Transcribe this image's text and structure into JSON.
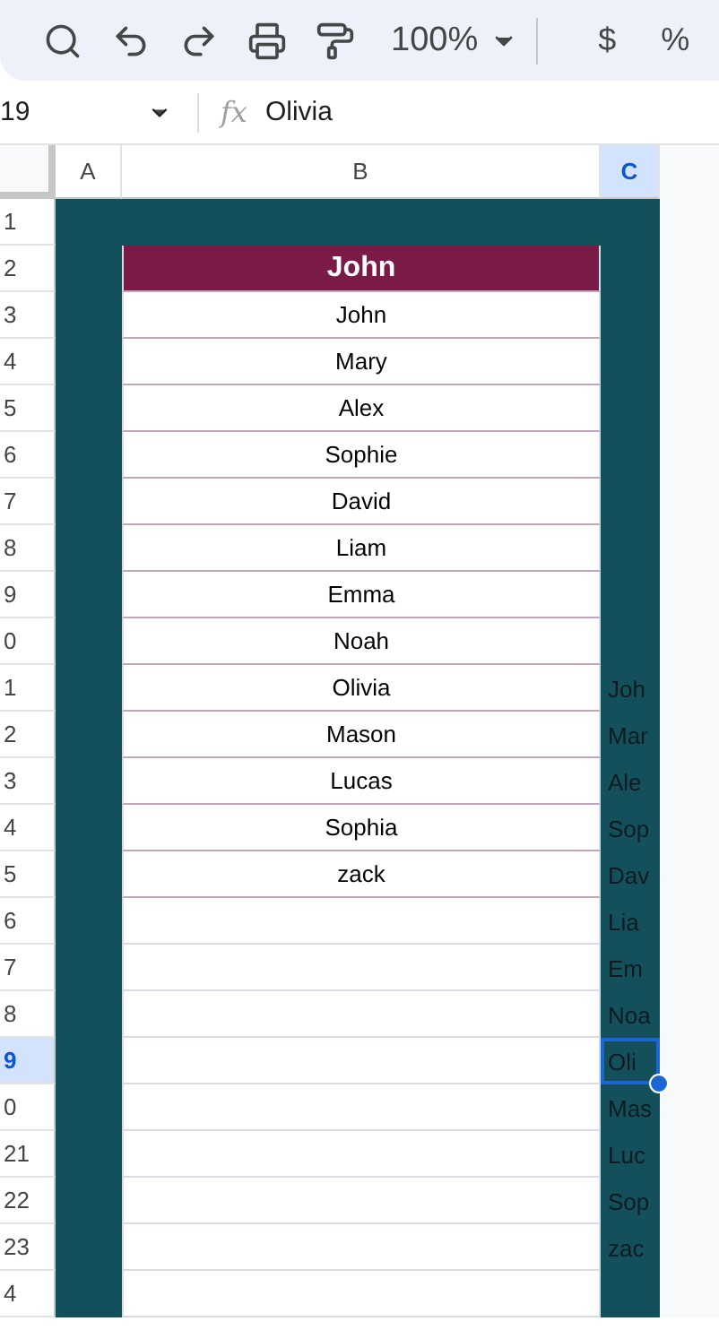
{
  "toolbar": {
    "zoom": "100%",
    "items": [
      "$",
      "%"
    ]
  },
  "formula_bar": {
    "cell_ref": "19",
    "function_label": "fx",
    "formula": "Olivia"
  },
  "columns": [
    {
      "label": "A",
      "selected": false
    },
    {
      "label": "B",
      "selected": false
    },
    {
      "label": "C",
      "selected": true
    }
  ],
  "rows": [
    {
      "number": "1",
      "selected": false,
      "b": {
        "kind": "none"
      }
    },
    {
      "number": "2",
      "selected": false,
      "b": {
        "kind": "header",
        "text": "John"
      }
    },
    {
      "number": "3",
      "selected": false,
      "b": {
        "kind": "entry",
        "text": "John"
      }
    },
    {
      "number": "4",
      "selected": false,
      "b": {
        "kind": "entry",
        "text": "Mary"
      }
    },
    {
      "number": "5",
      "selected": false,
      "b": {
        "kind": "entry",
        "text": "Alex"
      }
    },
    {
      "number": "6",
      "selected": false,
      "b": {
        "kind": "entry",
        "text": "Sophie"
      }
    },
    {
      "number": "7",
      "selected": false,
      "b": {
        "kind": "entry",
        "text": "David"
      }
    },
    {
      "number": "8",
      "selected": false,
      "b": {
        "kind": "entry",
        "text": "Liam"
      }
    },
    {
      "number": "9",
      "selected": false,
      "b": {
        "kind": "entry",
        "text": "Emma"
      }
    },
    {
      "number": "0",
      "selected": false,
      "b": {
        "kind": "entry",
        "text": "Noah"
      }
    },
    {
      "number": "1",
      "selected": false,
      "b": {
        "kind": "entry",
        "text": "Olivia"
      },
      "c": "Joh"
    },
    {
      "number": "2",
      "selected": false,
      "b": {
        "kind": "entry",
        "text": "Mason"
      },
      "c": "Mar"
    },
    {
      "number": "3",
      "selected": false,
      "b": {
        "kind": "entry",
        "text": "Lucas"
      },
      "c": "Ale"
    },
    {
      "number": "4",
      "selected": false,
      "b": {
        "kind": "entry",
        "text": "Sophia"
      },
      "c": "Sop"
    },
    {
      "number": "5",
      "selected": false,
      "b": {
        "kind": "entry",
        "text": "zack"
      },
      "c": "Dav"
    },
    {
      "number": "6",
      "selected": false,
      "b": {
        "kind": "empty"
      },
      "c": "Lia"
    },
    {
      "number": "7",
      "selected": false,
      "b": {
        "kind": "empty"
      },
      "c": "Em"
    },
    {
      "number": "8",
      "selected": false,
      "b": {
        "kind": "empty"
      },
      "c": "Noa"
    },
    {
      "number": "9",
      "selected": true,
      "b": {
        "kind": "empty"
      },
      "c": "Oli"
    },
    {
      "number": "0",
      "selected": false,
      "b": {
        "kind": "empty"
      },
      "c": "Mas"
    },
    {
      "number": "21",
      "selected": false,
      "b": {
        "kind": "empty"
      },
      "c": "Luc"
    },
    {
      "number": "22",
      "selected": false,
      "b": {
        "kind": "empty"
      },
      "c": "Sop"
    },
    {
      "number": "23",
      "selected": false,
      "b": {
        "kind": "empty"
      },
      "c": "zac"
    },
    {
      "number": "4",
      "selected": false,
      "b": {
        "kind": "empty"
      }
    }
  ]
}
